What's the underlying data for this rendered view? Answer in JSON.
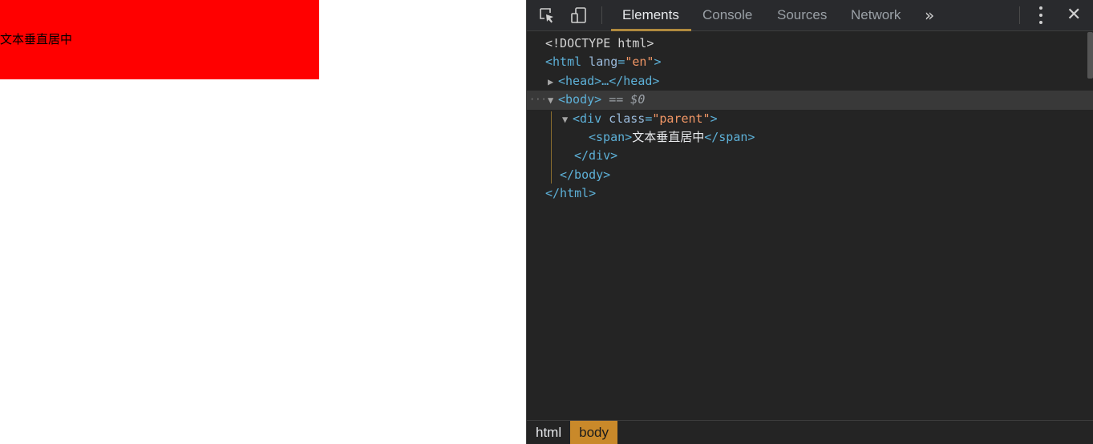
{
  "page": {
    "parent_text": "文本垂直居中",
    "parent_bg": "#ff0000"
  },
  "devtools": {
    "toolbar": {
      "inspect_icon": "inspect-element-icon",
      "device_icon": "device-toolbar-icon",
      "tabs": [
        "Elements",
        "Console",
        "Sources",
        "Network"
      ],
      "active_tab": "Elements",
      "more_tabs": "»",
      "close": "✕",
      "accent": "#b08a3e"
    },
    "tree": {
      "doctype": "<!DOCTYPE html>",
      "html_open_tag": "<html",
      "html_attr_name": " lang",
      "html_attr_eq": "=",
      "html_attr_val": "\"en\"",
      "html_open_close": ">",
      "head_collapsed": "<head>…</head>",
      "body_open": "<body>",
      "body_selected_marker": " == $0",
      "div_open_tag": "<div",
      "div_attr_name": " class",
      "div_attr_eq": "=",
      "div_attr_val": "\"parent\"",
      "div_open_close": ">",
      "span_open": "<span>",
      "span_text": "文本垂直居中",
      "span_close": "</span>",
      "div_close": "</div>",
      "body_close": "</body>",
      "html_close": "</html>"
    },
    "breadcrumb": {
      "items": [
        "html",
        "body"
      ],
      "active": "body"
    }
  }
}
